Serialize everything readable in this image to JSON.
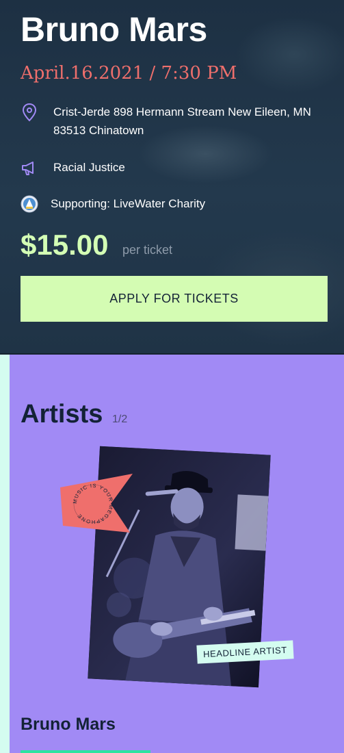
{
  "event": {
    "artist": "Bruno Mars",
    "date_time": "April.16.2021 / 7:30 PM",
    "address": "Crist-Jerde 898 Hermann Stream New Eileen, MN 83513 Chinatown",
    "cause": "Racial Justice",
    "supporting": "Supporting: LiveWater Charity",
    "price": "$15.00",
    "price_unit": "per ticket",
    "cta_label": "APPLY FOR TICKETS"
  },
  "artists": {
    "title": "Artists",
    "counter": "1/2",
    "sticker_text": "MUSIC IS YOUR MEGAPHONE",
    "badge": "HEADLINE ARTIST",
    "current_name": "Bruno Mars"
  },
  "icons": {
    "location": "map-pin-icon",
    "cause": "megaphone-icon",
    "charity": "charity-logo-icon"
  },
  "colors": {
    "hero_bg": "#1f3347",
    "accent_coral": "#ef6f6c",
    "accent_lime": "#d4fcb3",
    "artists_bg": "#a18af5",
    "badge_bg": "#d4fcf0",
    "text_dark": "#132236"
  }
}
